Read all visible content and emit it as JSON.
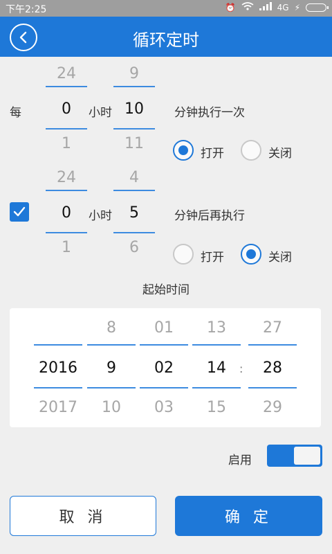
{
  "status_bar": {
    "time": "下午2:25",
    "network": "4G",
    "battery_icon": "battery-icon"
  },
  "header": {
    "title": "循环定时",
    "back_icon": "back-icon"
  },
  "interval": {
    "prefix": "每",
    "hour_label": "小时",
    "hours": {
      "prev": "24",
      "current": "0",
      "next": "1"
    },
    "minutes": {
      "prev": "9",
      "current": "10",
      "next": "11"
    },
    "suffix": "分钟执行一次",
    "radio_on_label": "打开",
    "radio_off_label": "关闭",
    "selected": "on"
  },
  "delay": {
    "checked": true,
    "hour_label": "小时",
    "hours": {
      "prev": "24",
      "current": "0",
      "next": "1"
    },
    "minutes": {
      "prev": "4",
      "current": "5",
      "next": "6"
    },
    "suffix": "分钟后再执行",
    "radio_on_label": "打开",
    "radio_off_label": "关闭",
    "selected": "off"
  },
  "start_time": {
    "label": "起始时间",
    "year": {
      "prev": "",
      "current": "2016",
      "next": "2017"
    },
    "month": {
      "prev": "8",
      "current": "9",
      "next": "10"
    },
    "day": {
      "prev": "01",
      "current": "02",
      "next": "03"
    },
    "hour": {
      "prev": "13",
      "current": "14",
      "next": "15"
    },
    "separator": ":",
    "minute": {
      "prev": "27",
      "current": "28",
      "next": "29"
    }
  },
  "enable": {
    "label": "启用",
    "on": true
  },
  "footer": {
    "cancel_label": "取 消",
    "confirm_label": "确 定"
  },
  "colors": {
    "accent": "#1e78d8",
    "background": "#efefef"
  }
}
